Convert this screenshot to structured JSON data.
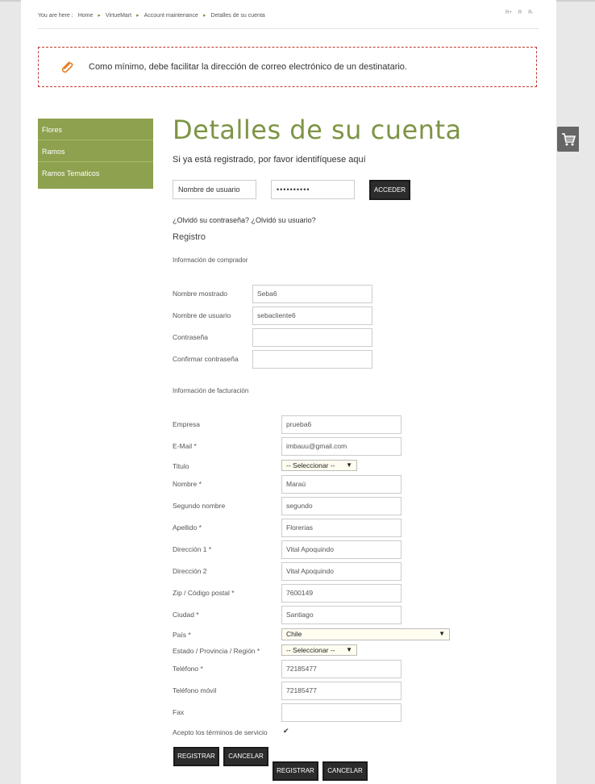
{
  "breadcrumb": {
    "lead": "You are here :",
    "items": [
      "Home",
      "VirtueMart",
      "Account maintenance",
      "Detalles de su cuenta"
    ]
  },
  "font_size_controls": [
    "R+",
    "R",
    "R-"
  ],
  "notice": {
    "message": "Como mínimo, debe facilitar la dirección de correo electrónico de un destinatario."
  },
  "sidebar": {
    "items": [
      "Flores",
      "Ramos",
      "Ramos Tematicos"
    ]
  },
  "main": {
    "title": "Detalles de su cuenta",
    "subtitle": "Si ya está registrado, por favor identifíquese aquí"
  },
  "login": {
    "username_placeholder": "Nombre de usuario",
    "password_mask": "••••••••••",
    "button": "ACCEDER",
    "forgot": "¿Olvidó su contraseña? ¿Olvidó su usuario?"
  },
  "registro": {
    "heading": "Registro",
    "buyer_section": "Información de comprador",
    "billing_section": "Información de facturación"
  },
  "buyer_fields": [
    {
      "label": "Nombre mostrado",
      "value": "Seba6"
    },
    {
      "label": "Nombre de usuario",
      "value": "sebacliente6"
    },
    {
      "label": "Contraseña",
      "value": ""
    },
    {
      "label": "Confirmar contraseña",
      "value": ""
    }
  ],
  "billing": {
    "empresa": {
      "label": "Empresa",
      "value": "prueba6"
    },
    "email": {
      "label": "E-Mail *",
      "value": "imbauu@gmail.com"
    },
    "titulo": {
      "label": "Titulo",
      "value": "-- Seleccionar --"
    },
    "nombre": {
      "label": "Nombre *",
      "value": "Maraú"
    },
    "segundo": {
      "label": "Segundo nombre",
      "value": "segundo"
    },
    "apellido": {
      "label": "Apellido *",
      "value": "Florerias"
    },
    "dir1": {
      "label": "Dirección 1 *",
      "value": "Vital Apoquindo"
    },
    "dir2": {
      "label": "Dirección 2",
      "value": "Vital Apoquindo"
    },
    "zip": {
      "label": "Zip / Código postal *",
      "value": "7600149"
    },
    "ciudad": {
      "label": "Ciudad *",
      "value": "Santiago"
    },
    "pais": {
      "label": "País *",
      "value": "Chile"
    },
    "estado": {
      "label": "Estado / Provincia / Región *",
      "value": "-- Seleccionar --"
    },
    "telefono": {
      "label": "Teléfono *",
      "value": "72185477"
    },
    "movil": {
      "label": "Teléfono móvil",
      "value": "72185477"
    },
    "fax": {
      "label": "Fax",
      "value": ""
    },
    "terminos": {
      "label": "Acepto los términos de servicio",
      "checked": true
    }
  },
  "buttons": {
    "register": "REGISTRAR",
    "cancel": "CANCELAR"
  },
  "icons": {
    "attachment": "paperclip-icon",
    "cart": "cart-icon"
  },
  "colors": {
    "accent": "#8da14e",
    "title": "#7d9444",
    "button": "#2c2c2c",
    "notice_border": "#c0392b"
  }
}
